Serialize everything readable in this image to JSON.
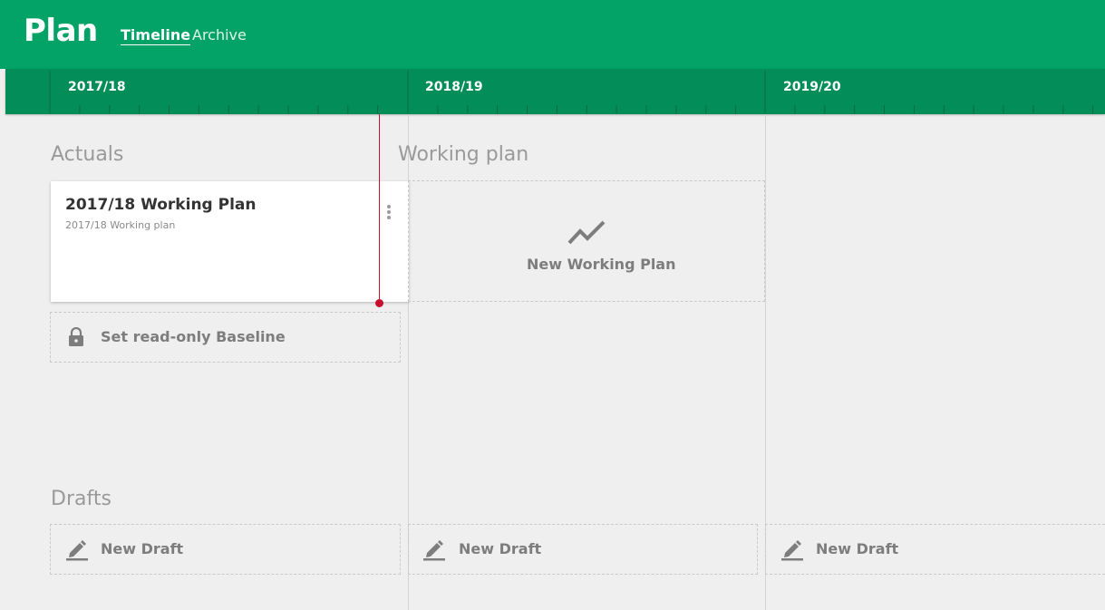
{
  "header": {
    "title": "Plan",
    "tabs": [
      {
        "label": "Timeline",
        "active": true
      },
      {
        "label": "Archive",
        "active": false
      }
    ],
    "accent_color": "#03a266",
    "timeline_color": "#038d58"
  },
  "timeline": {
    "years": [
      "2017/18",
      "2018/19",
      "2019/20"
    ]
  },
  "sections": {
    "actuals": "Actuals",
    "working_plan": "Working plan",
    "drafts": "Drafts"
  },
  "plan_card": {
    "title": "2017/18 Working Plan",
    "subtitle": "2017/18 Working plan",
    "menu_icon": "more-vertical-icon"
  },
  "actions": {
    "baseline": {
      "label": "Set read-only Baseline",
      "icon": "lock-icon"
    },
    "new_working_plan": {
      "label": "New Working Plan",
      "icon": "trend-line-icon"
    },
    "new_draft": {
      "label": "New Draft",
      "icon": "pencil-icon"
    }
  },
  "today_marker_color": "#c8102e"
}
